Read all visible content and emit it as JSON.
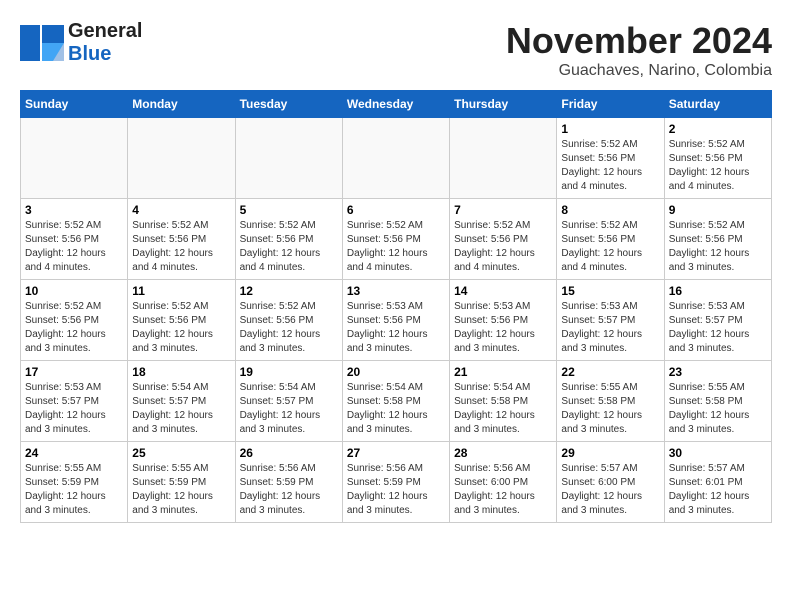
{
  "logo": {
    "text_general": "General",
    "text_blue": "Blue"
  },
  "title": {
    "month_year": "November 2024",
    "location": "Guachaves, Narino, Colombia"
  },
  "weekdays": [
    "Sunday",
    "Monday",
    "Tuesday",
    "Wednesday",
    "Thursday",
    "Friday",
    "Saturday"
  ],
  "weeks": [
    [
      {
        "day": "",
        "info": ""
      },
      {
        "day": "",
        "info": ""
      },
      {
        "day": "",
        "info": ""
      },
      {
        "day": "",
        "info": ""
      },
      {
        "day": "",
        "info": ""
      },
      {
        "day": "1",
        "info": "Sunrise: 5:52 AM\nSunset: 5:56 PM\nDaylight: 12 hours and 4 minutes."
      },
      {
        "day": "2",
        "info": "Sunrise: 5:52 AM\nSunset: 5:56 PM\nDaylight: 12 hours and 4 minutes."
      }
    ],
    [
      {
        "day": "3",
        "info": "Sunrise: 5:52 AM\nSunset: 5:56 PM\nDaylight: 12 hours and 4 minutes."
      },
      {
        "day": "4",
        "info": "Sunrise: 5:52 AM\nSunset: 5:56 PM\nDaylight: 12 hours and 4 minutes."
      },
      {
        "day": "5",
        "info": "Sunrise: 5:52 AM\nSunset: 5:56 PM\nDaylight: 12 hours and 4 minutes."
      },
      {
        "day": "6",
        "info": "Sunrise: 5:52 AM\nSunset: 5:56 PM\nDaylight: 12 hours and 4 minutes."
      },
      {
        "day": "7",
        "info": "Sunrise: 5:52 AM\nSunset: 5:56 PM\nDaylight: 12 hours and 4 minutes."
      },
      {
        "day": "8",
        "info": "Sunrise: 5:52 AM\nSunset: 5:56 PM\nDaylight: 12 hours and 4 minutes."
      },
      {
        "day": "9",
        "info": "Sunrise: 5:52 AM\nSunset: 5:56 PM\nDaylight: 12 hours and 3 minutes."
      }
    ],
    [
      {
        "day": "10",
        "info": "Sunrise: 5:52 AM\nSunset: 5:56 PM\nDaylight: 12 hours and 3 minutes."
      },
      {
        "day": "11",
        "info": "Sunrise: 5:52 AM\nSunset: 5:56 PM\nDaylight: 12 hours and 3 minutes."
      },
      {
        "day": "12",
        "info": "Sunrise: 5:52 AM\nSunset: 5:56 PM\nDaylight: 12 hours and 3 minutes."
      },
      {
        "day": "13",
        "info": "Sunrise: 5:53 AM\nSunset: 5:56 PM\nDaylight: 12 hours and 3 minutes."
      },
      {
        "day": "14",
        "info": "Sunrise: 5:53 AM\nSunset: 5:56 PM\nDaylight: 12 hours and 3 minutes."
      },
      {
        "day": "15",
        "info": "Sunrise: 5:53 AM\nSunset: 5:57 PM\nDaylight: 12 hours and 3 minutes."
      },
      {
        "day": "16",
        "info": "Sunrise: 5:53 AM\nSunset: 5:57 PM\nDaylight: 12 hours and 3 minutes."
      }
    ],
    [
      {
        "day": "17",
        "info": "Sunrise: 5:53 AM\nSunset: 5:57 PM\nDaylight: 12 hours and 3 minutes."
      },
      {
        "day": "18",
        "info": "Sunrise: 5:54 AM\nSunset: 5:57 PM\nDaylight: 12 hours and 3 minutes."
      },
      {
        "day": "19",
        "info": "Sunrise: 5:54 AM\nSunset: 5:57 PM\nDaylight: 12 hours and 3 minutes."
      },
      {
        "day": "20",
        "info": "Sunrise: 5:54 AM\nSunset: 5:58 PM\nDaylight: 12 hours and 3 minutes."
      },
      {
        "day": "21",
        "info": "Sunrise: 5:54 AM\nSunset: 5:58 PM\nDaylight: 12 hours and 3 minutes."
      },
      {
        "day": "22",
        "info": "Sunrise: 5:55 AM\nSunset: 5:58 PM\nDaylight: 12 hours and 3 minutes."
      },
      {
        "day": "23",
        "info": "Sunrise: 5:55 AM\nSunset: 5:58 PM\nDaylight: 12 hours and 3 minutes."
      }
    ],
    [
      {
        "day": "24",
        "info": "Sunrise: 5:55 AM\nSunset: 5:59 PM\nDaylight: 12 hours and 3 minutes."
      },
      {
        "day": "25",
        "info": "Sunrise: 5:55 AM\nSunset: 5:59 PM\nDaylight: 12 hours and 3 minutes."
      },
      {
        "day": "26",
        "info": "Sunrise: 5:56 AM\nSunset: 5:59 PM\nDaylight: 12 hours and 3 minutes."
      },
      {
        "day": "27",
        "info": "Sunrise: 5:56 AM\nSunset: 5:59 PM\nDaylight: 12 hours and 3 minutes."
      },
      {
        "day": "28",
        "info": "Sunrise: 5:56 AM\nSunset: 6:00 PM\nDaylight: 12 hours and 3 minutes."
      },
      {
        "day": "29",
        "info": "Sunrise: 5:57 AM\nSunset: 6:00 PM\nDaylight: 12 hours and 3 minutes."
      },
      {
        "day": "30",
        "info": "Sunrise: 5:57 AM\nSunset: 6:01 PM\nDaylight: 12 hours and 3 minutes."
      }
    ]
  ]
}
